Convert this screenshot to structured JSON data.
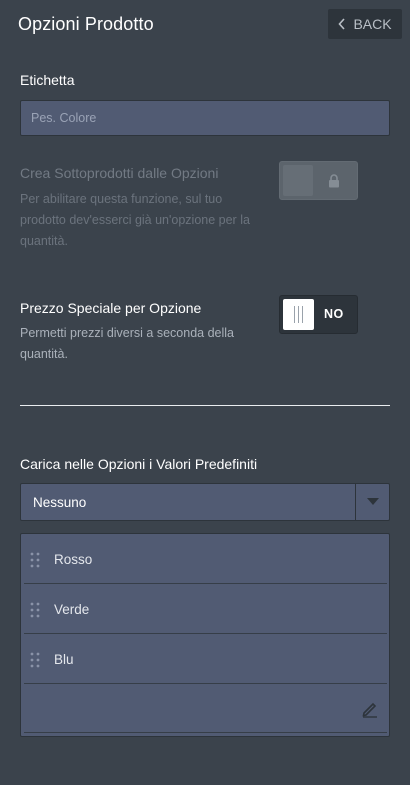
{
  "header": {
    "title": "Opzioni Prodotto",
    "back_label": "BACK"
  },
  "label_field": {
    "label": "Etichetta",
    "placeholder": "Pes. Colore",
    "value": ""
  },
  "subproducts": {
    "label": "Crea Sottoprodotti dalle Opzioni",
    "description": "Per abilitare questa funzione, sul tuo prodotto dev'esserci già un'opzione per la quantità.",
    "enabled": false,
    "locked": true
  },
  "special_price": {
    "label": "Prezzo Speciale per Opzione",
    "description": "Permetti prezzi diversi a seconda della quantità.",
    "toggle_state": "NO"
  },
  "defaults": {
    "label": "Carica nelle Opzioni i Valori Predefiniti",
    "selected": "Nessuno"
  },
  "options": {
    "items": [
      {
        "label": "Rosso"
      },
      {
        "label": "Verde"
      },
      {
        "label": "Blu"
      }
    ],
    "new_item_value": ""
  },
  "colors": {
    "background": "#3b434c",
    "input_bg": "#515b73",
    "dark": "#2d343b",
    "text": "#ffffff",
    "muted": "#aab1ba"
  },
  "icons": {
    "back": "chevron-left-icon",
    "lock": "lock-icon",
    "grip": "drag-handle-icon",
    "dropdown": "caret-down-icon",
    "edit": "pencil-icon"
  }
}
